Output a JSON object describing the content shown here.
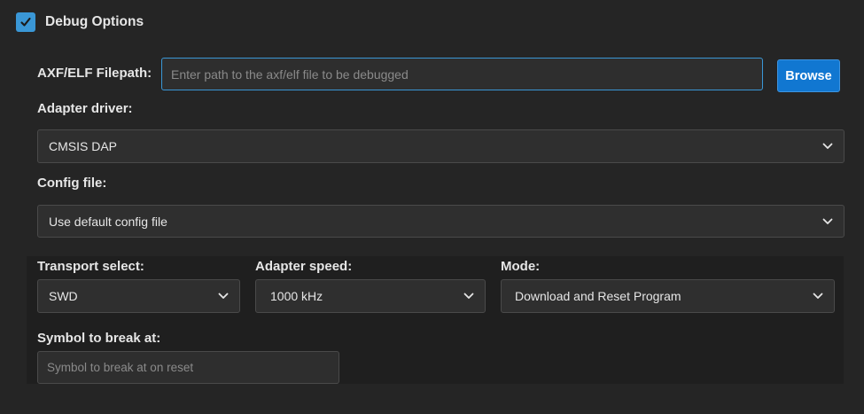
{
  "header": {
    "title": "Debug Options",
    "checked": true
  },
  "filepath": {
    "label": "AXF/ELF Filepath:",
    "placeholder": "Enter path to the axf/elf file to be debugged",
    "value": "",
    "browse_label": "Browse"
  },
  "adapter_driver": {
    "label": "Adapter driver:",
    "selected": "CMSIS DAP"
  },
  "config_file": {
    "label": "Config file:",
    "selected": "Use default config file"
  },
  "transport": {
    "label": "Transport select:",
    "selected": "SWD"
  },
  "adapter_speed": {
    "label": "Adapter speed:",
    "selected": "1000 kHz"
  },
  "mode": {
    "label": "Mode:",
    "selected": "Download and Reset Program"
  },
  "symbol": {
    "label": "Symbol to break at:",
    "placeholder": "Symbol to break at on reset",
    "value": ""
  },
  "colors": {
    "background": "#252525",
    "accent": "#3a97d6",
    "button": "#1177d1"
  }
}
